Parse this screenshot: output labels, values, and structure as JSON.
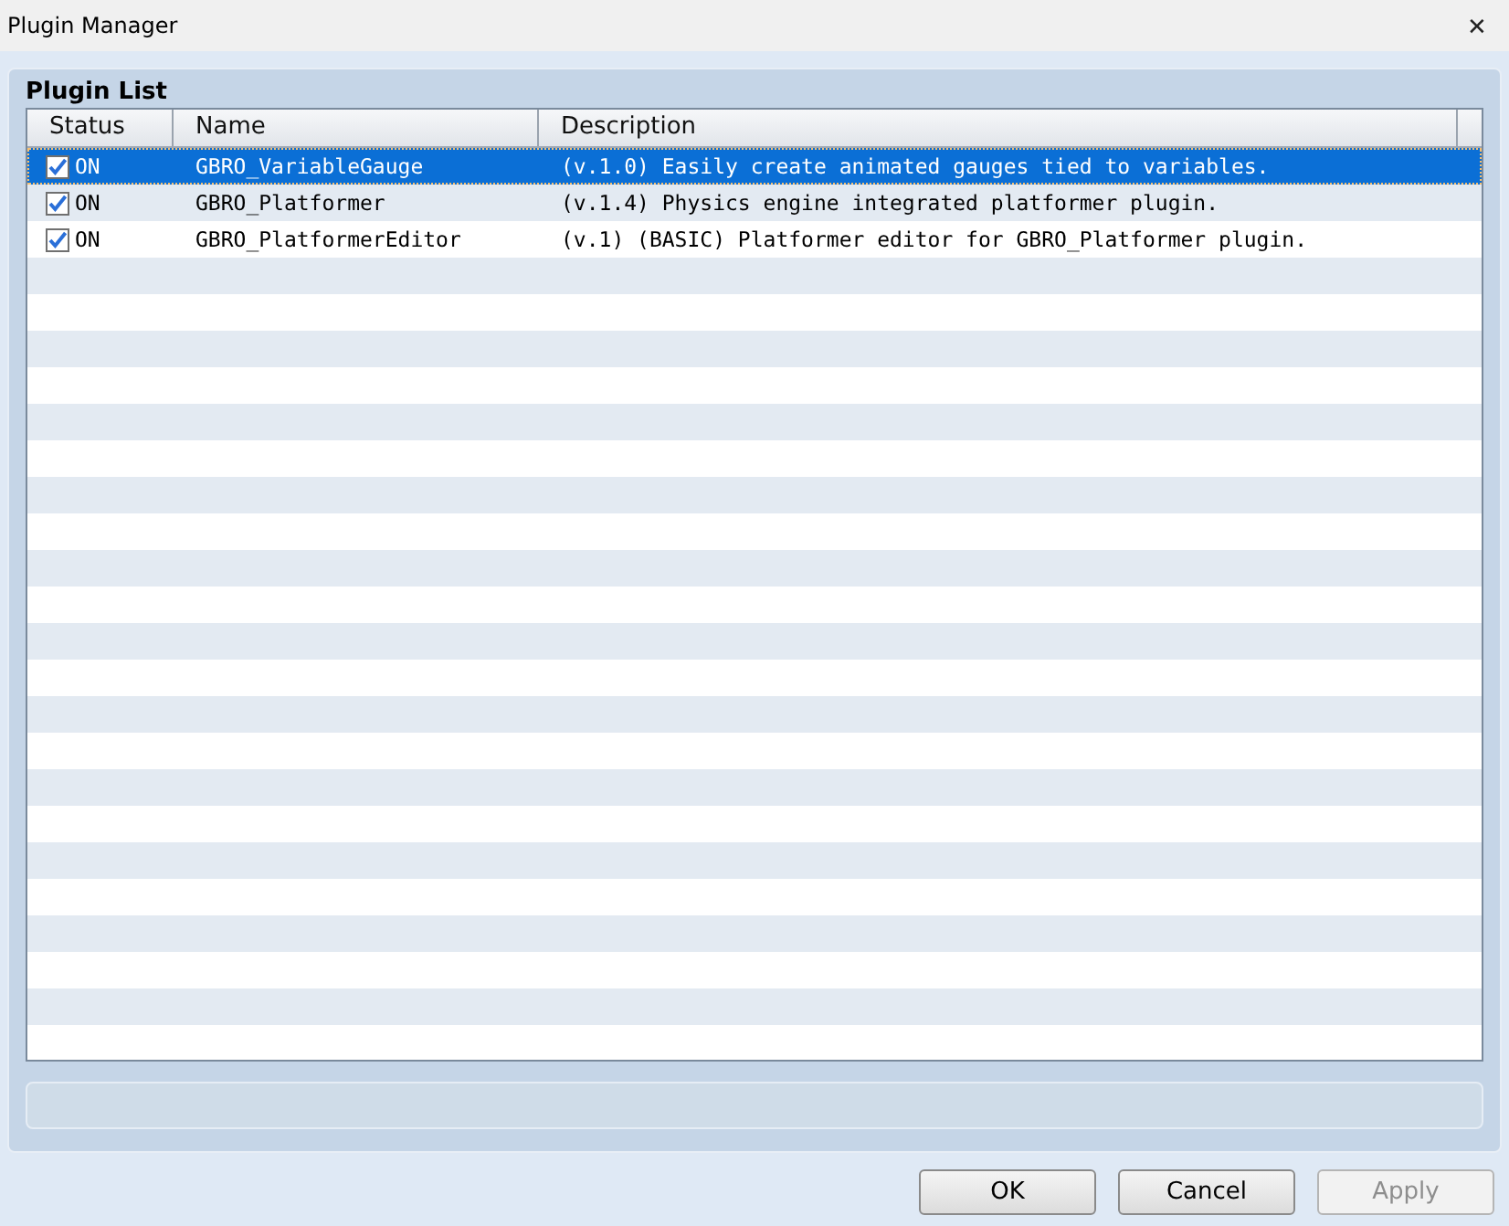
{
  "window": {
    "title": "Plugin Manager",
    "close": "✕"
  },
  "panel": {
    "title": "Plugin List"
  },
  "table": {
    "columns": [
      "Status",
      "Name",
      "Description"
    ],
    "rows": [
      {
        "checked": true,
        "status": "ON",
        "name": "GBRO_VariableGauge",
        "description": "(v.1.0) Easily create animated gauges tied to variables.",
        "selected": true
      },
      {
        "checked": true,
        "status": "ON",
        "name": "GBRO_Platformer",
        "description": "(v.1.4) Physics engine integrated platformer plugin.",
        "selected": false
      },
      {
        "checked": true,
        "status": "ON",
        "name": "GBRO_PlatformerEditor",
        "description": "(v.1) (BASIC) Platformer editor for GBRO_Platformer plugin.",
        "selected": false
      }
    ]
  },
  "buttons": [
    {
      "label": "OK",
      "disabled": false
    },
    {
      "label": "Cancel",
      "disabled": false
    },
    {
      "label": "Apply",
      "disabled": true
    }
  ]
}
